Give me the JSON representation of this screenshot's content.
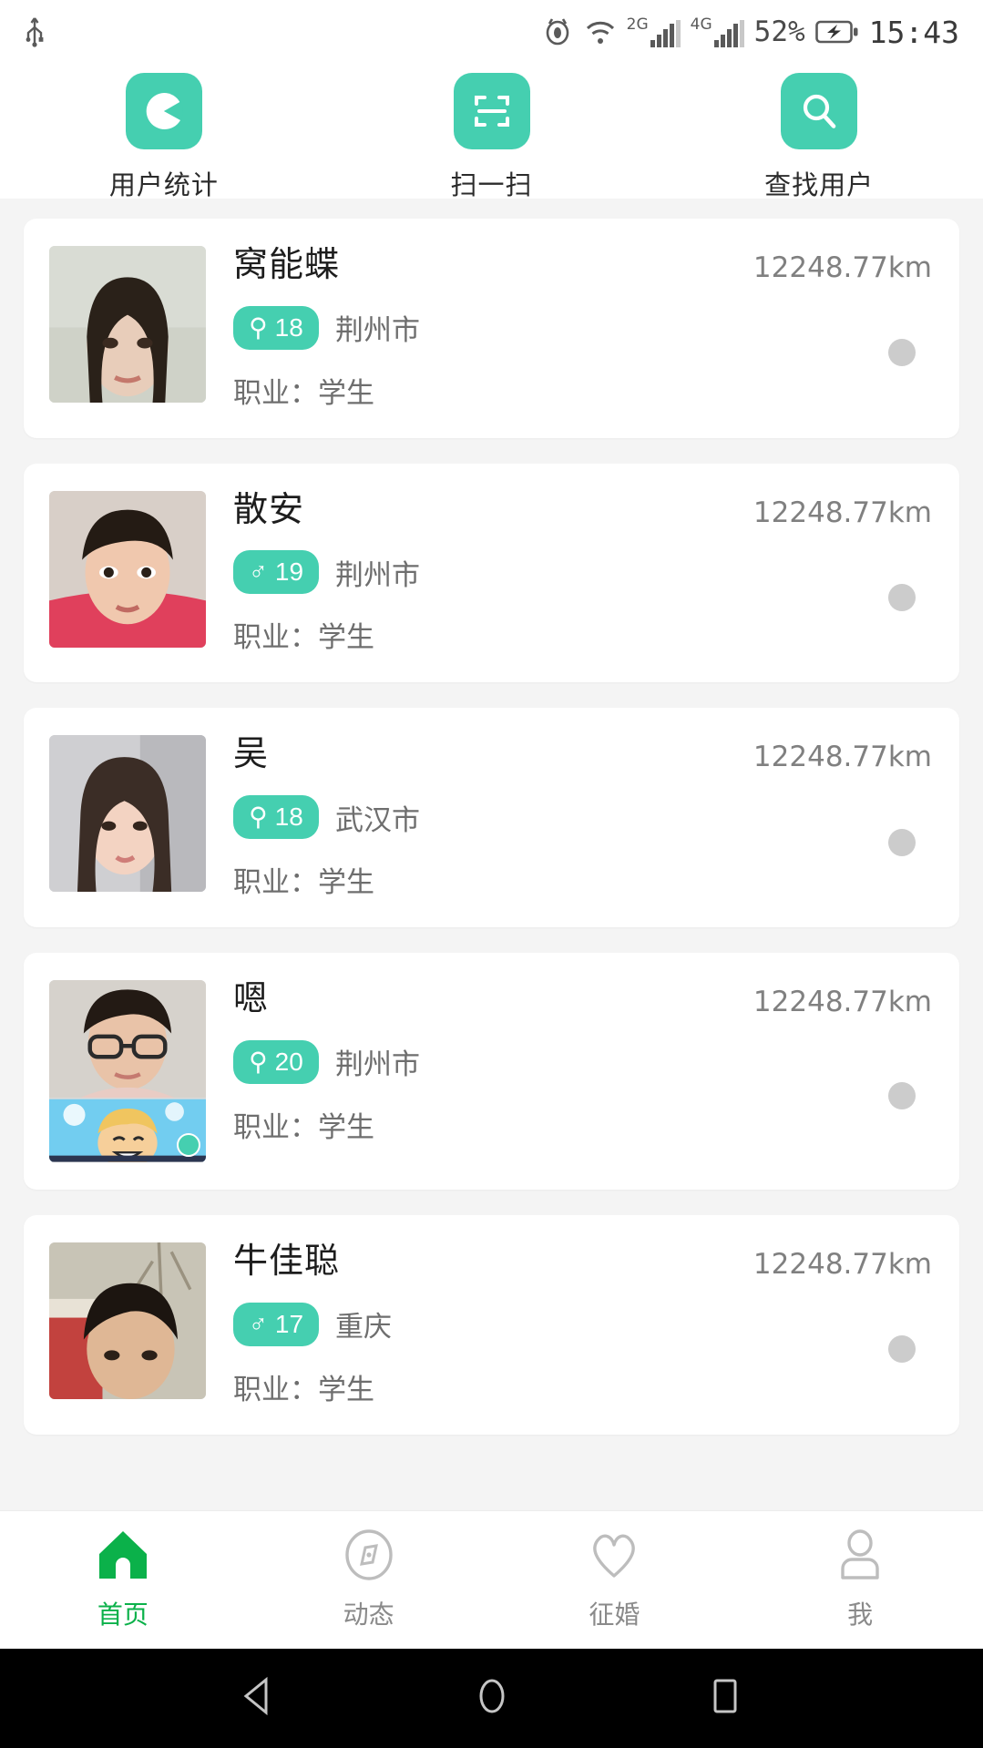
{
  "status_bar": {
    "usb_icon": "usb-icon",
    "eye_icon": "eye-care-icon",
    "wifi_icon": "wifi-icon",
    "net1_label": "2G",
    "net2_label": "4G",
    "battery_percent": "52%",
    "battery_icon": "battery-charging-icon",
    "clock": "15:43"
  },
  "quick_actions": [
    {
      "label": "用户统计",
      "icon": "pie-chart-icon"
    },
    {
      "label": "扫一扫",
      "icon": "scan-qr-icon"
    },
    {
      "label": "查找用户",
      "icon": "search-icon"
    }
  ],
  "accent_color": "#45cfb0",
  "active_tab_color": "#0bb14a",
  "status_dot_color": "#cccccc",
  "users": [
    {
      "name": "窝能蝶",
      "distance": "12248.77km",
      "gender": "female",
      "gender_symbol": "⚲",
      "age": "18",
      "city": "荆州市",
      "occupation": "职业：学生",
      "online": false
    },
    {
      "name": "散安",
      "distance": "12248.77km",
      "gender": "male",
      "gender_symbol": "♂",
      "age": "19",
      "city": "荆州市",
      "occupation": "职业：学生",
      "online": false
    },
    {
      "name": "吴",
      "distance": "12248.77km",
      "gender": "female",
      "gender_symbol": "⚲",
      "age": "18",
      "city": "武汉市",
      "occupation": "职业：学生",
      "online": false
    },
    {
      "name": "嗯",
      "distance": "12248.77km",
      "gender": "female",
      "gender_symbol": "⚲",
      "age": "20",
      "city": "荆州市",
      "occupation": "职业：学生",
      "online": false
    },
    {
      "name": "牛佳聪",
      "distance": "12248.77km",
      "gender": "male",
      "gender_symbol": "♂",
      "age": "17",
      "city": "重庆",
      "occupation": "职业：学生",
      "online": false
    }
  ],
  "tabs": [
    {
      "label": "首页",
      "icon": "home-icon",
      "active": true
    },
    {
      "label": "动态",
      "icon": "compass-icon",
      "active": false
    },
    {
      "label": "征婚",
      "icon": "heart-icon",
      "active": false
    },
    {
      "label": "我",
      "icon": "person-icon",
      "active": false
    }
  ],
  "android_nav": {
    "back": "back-triangle-icon",
    "home": "home-circle-icon",
    "recents": "recents-square-icon"
  }
}
